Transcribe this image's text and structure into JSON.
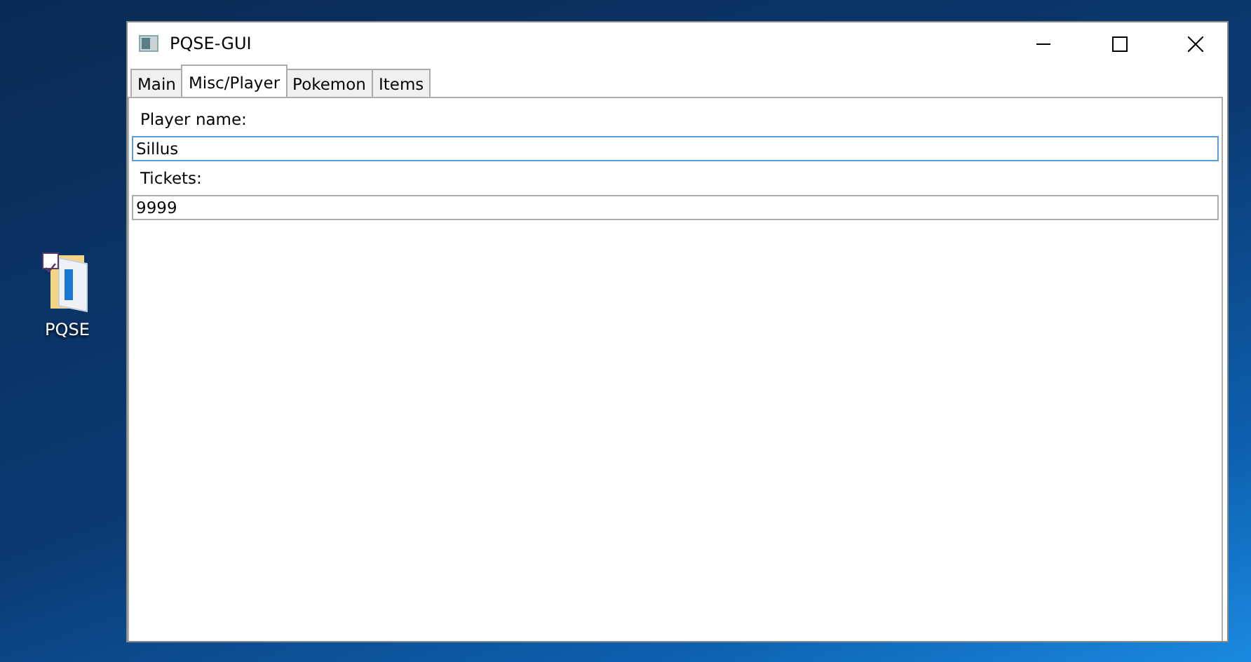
{
  "desktop": {
    "icons": [
      {
        "label": "PQSE",
        "checked": true
      }
    ]
  },
  "window": {
    "title": "PQSE-GUI"
  },
  "tabs": [
    {
      "label": "Main",
      "selected": false
    },
    {
      "label": "Misc/Player",
      "selected": true
    },
    {
      "label": "Pokemon",
      "selected": false
    },
    {
      "label": "Items",
      "selected": false
    }
  ],
  "fields": [
    {
      "label": "Player name:",
      "value": "Sillus",
      "focused": true
    },
    {
      "label": "Tickets:",
      "value": "9999",
      "focused": false
    }
  ]
}
